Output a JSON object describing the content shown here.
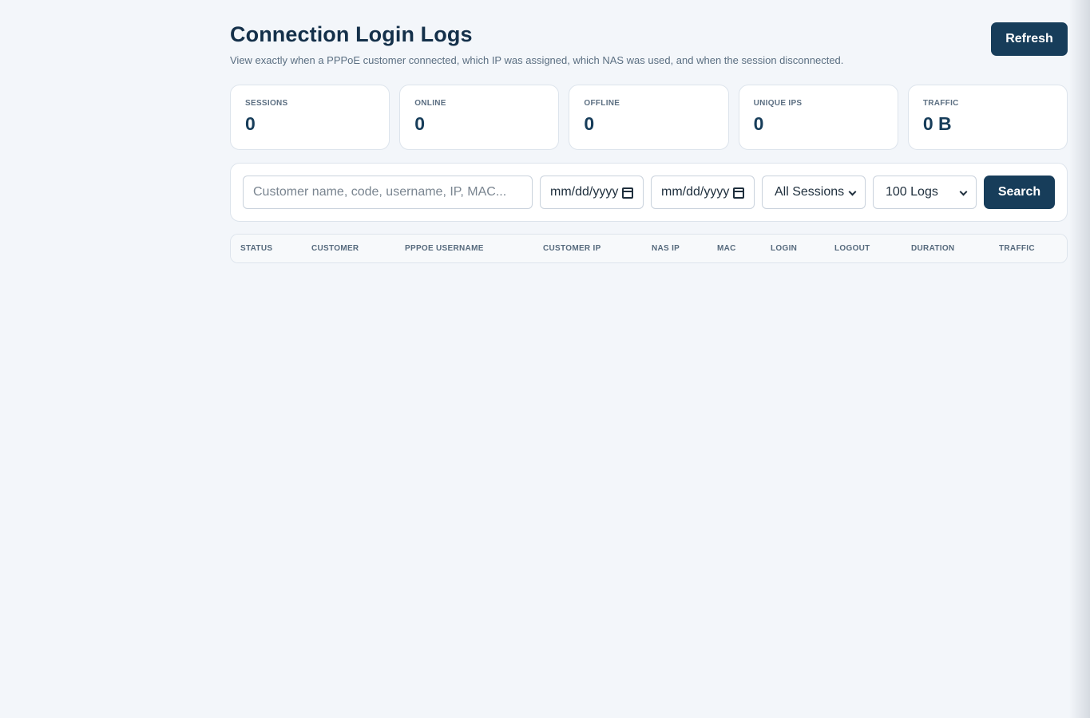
{
  "header": {
    "title": "Connection Login Logs",
    "subtitle": "View exactly when a PPPoE customer connected, which IP was assigned, which NAS was used, and when the session disconnected.",
    "refresh_label": "Refresh"
  },
  "stats": [
    {
      "label": "SESSIONS",
      "value": "0"
    },
    {
      "label": "ONLINE",
      "value": "0"
    },
    {
      "label": "OFFLINE",
      "value": "0"
    },
    {
      "label": "UNIQUE IPS",
      "value": "0"
    },
    {
      "label": "TRAFFIC",
      "value": "0 B"
    }
  ],
  "filters": {
    "search_placeholder": "Customer name, code, username, IP, MAC...",
    "date_from_placeholder": "mm/dd/yyyy",
    "date_to_placeholder": "mm/dd/yyyy",
    "session_filter": "All Sessions",
    "log_limit": "100 Logs",
    "search_label": "Search"
  },
  "table": {
    "columns": [
      "STATUS",
      "CUSTOMER",
      "PPPOE USERNAME",
      "CUSTOMER IP",
      "NAS IP",
      "MAC",
      "LOGIN",
      "LOGOUT",
      "DURATION",
      "TRAFFIC"
    ],
    "rows": []
  }
}
